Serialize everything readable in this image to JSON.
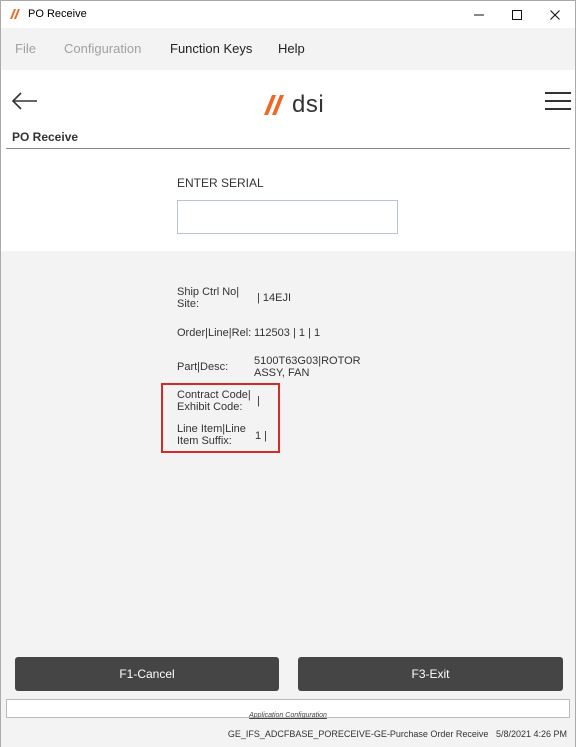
{
  "window": {
    "title": "PO Receive"
  },
  "menu": [
    {
      "label": "File",
      "enabled": false
    },
    {
      "label": "Configuration",
      "enabled": false
    },
    {
      "label": "Function Keys",
      "enabled": true
    },
    {
      "label": "Help",
      "enabled": true
    }
  ],
  "header": {
    "logo_text": "dsi",
    "page_title": "PO Receive"
  },
  "serial": {
    "label": "ENTER SERIAL",
    "value": ""
  },
  "details": [
    {
      "label": "Ship Ctrl No| Site:",
      "value": "| 14EJI"
    },
    {
      "label": "Order|Line|Rel:",
      "value": "112503 | 1 | 1"
    },
    {
      "label": "Part|Desc:",
      "value": "5100T63G03|ROTOR ASSY, FAN"
    },
    {
      "label": "Contract Code| Exhibit Code:",
      "value": "|"
    },
    {
      "label": "Line Item|Line Item Suffix:",
      "value": "1 |"
    }
  ],
  "buttons": {
    "cancel": "F1-Cancel",
    "exit": "F3-Exit"
  },
  "footer": {
    "app_config_link": "Application Configuration"
  },
  "status": {
    "app_id": "GE_IFS_ADCFBASE_PORECEIVE-GE-Purchase Order Receive",
    "timestamp": "5/8/2021 4:26 PM"
  },
  "colors": {
    "brand_orange": "#f26522",
    "highlight": "#d42a2a",
    "button_bg": "#454545"
  }
}
